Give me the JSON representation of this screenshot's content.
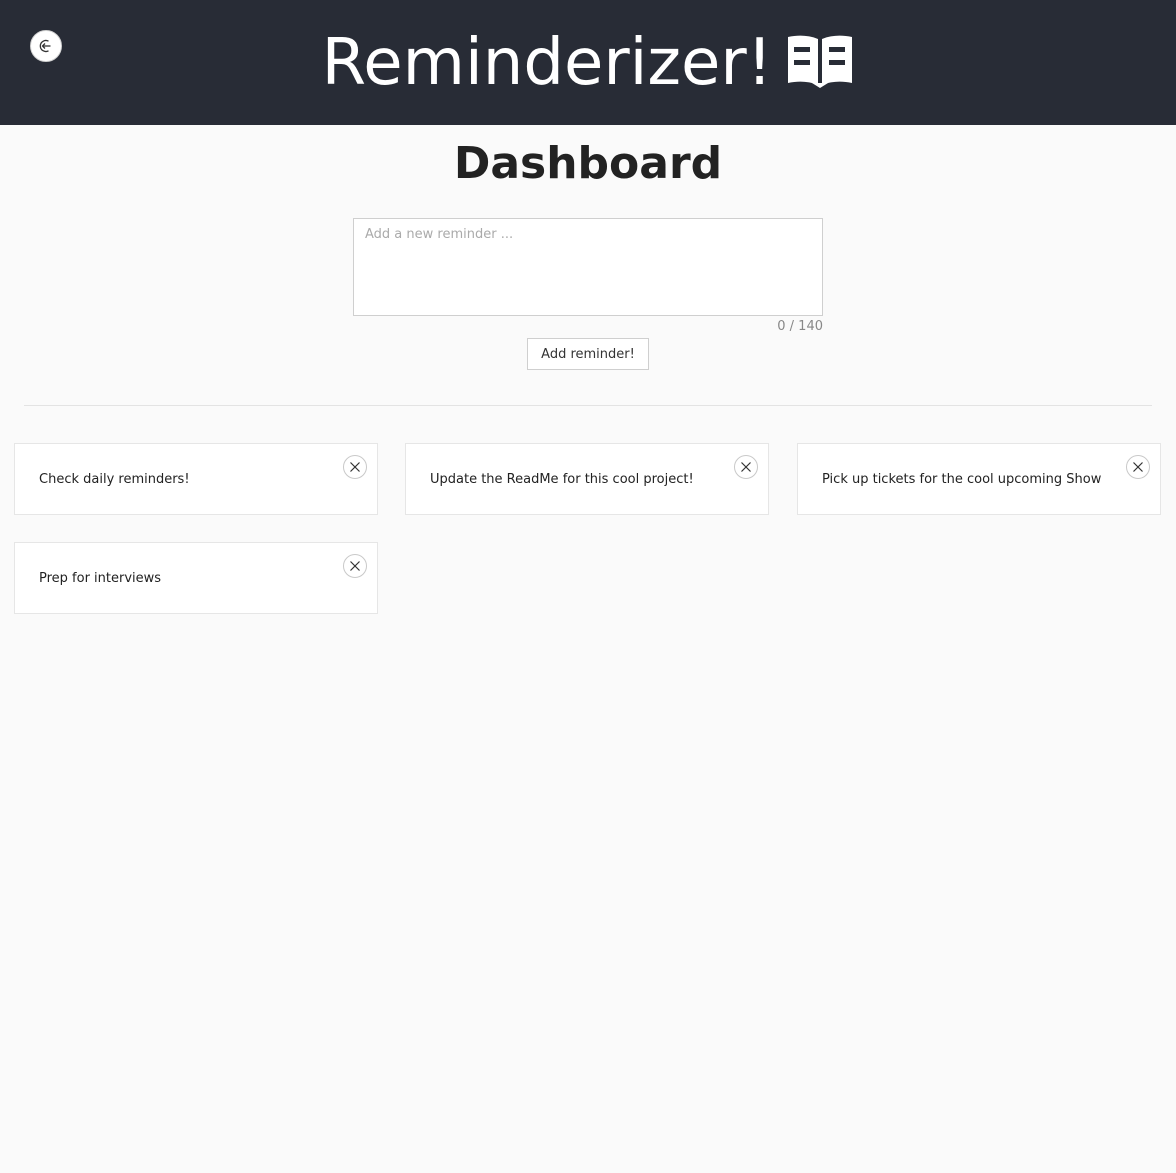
{
  "header": {
    "title": "Reminderizer!",
    "logout_icon": "logout-icon",
    "brand_icon": "book-open-icon",
    "background": "#282c36"
  },
  "page": {
    "title": "Dashboard"
  },
  "form": {
    "placeholder": "Add a new reminder ...",
    "value": "",
    "counter": "0 / 140",
    "submit_label": "Add reminder!"
  },
  "reminders": [
    {
      "text": "Check daily reminders!"
    },
    {
      "text": "Update the ReadMe for this cool project!"
    },
    {
      "text": "Pick up tickets for the cool upcoming Show"
    },
    {
      "text": "Prep for interviews"
    }
  ],
  "icons": {
    "remove": "close-icon"
  }
}
